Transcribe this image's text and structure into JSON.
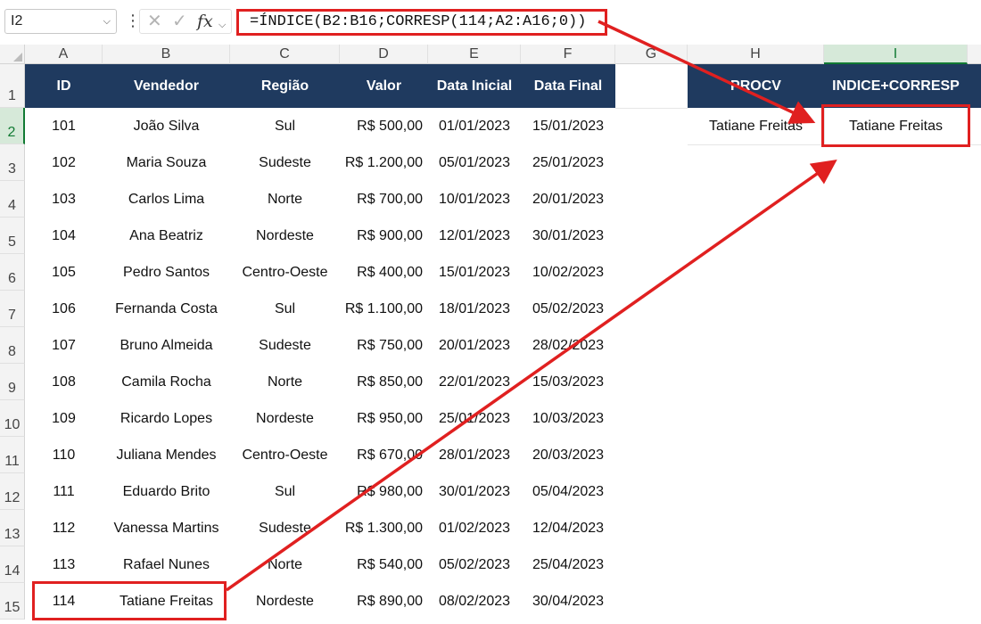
{
  "formula_bar": {
    "name_box": "I2",
    "cancel_glyph": "✕",
    "enter_glyph": "✓",
    "fx_label": "fx",
    "formula": "=ÍNDICE(B2:B16;CORRESP(114;A2:A16;0))"
  },
  "columns": [
    "A",
    "B",
    "C",
    "D",
    "E",
    "F",
    "G",
    "H",
    "I"
  ],
  "rows": [
    "1",
    "2",
    "3",
    "4",
    "5",
    "6",
    "7",
    "8",
    "9",
    "10",
    "11",
    "12",
    "13",
    "14",
    "15"
  ],
  "table": {
    "headers": [
      "ID",
      "Vendedor",
      "Região",
      "Valor",
      "Data Inicial",
      "Data Final"
    ],
    "rows": [
      [
        "101",
        "João Silva",
        "Sul",
        "R$ 500,00",
        "01/01/2023",
        "15/01/2023"
      ],
      [
        "102",
        "Maria Souza",
        "Sudeste",
        "R$ 1.200,00",
        "05/01/2023",
        "25/01/2023"
      ],
      [
        "103",
        "Carlos Lima",
        "Norte",
        "R$ 700,00",
        "10/01/2023",
        "20/01/2023"
      ],
      [
        "104",
        "Ana Beatriz",
        "Nordeste",
        "R$ 900,00",
        "12/01/2023",
        "30/01/2023"
      ],
      [
        "105",
        "Pedro Santos",
        "Centro-Oeste",
        "R$ 400,00",
        "15/01/2023",
        "10/02/2023"
      ],
      [
        "106",
        "Fernanda Costa",
        "Sul",
        "R$ 1.100,00",
        "18/01/2023",
        "05/02/2023"
      ],
      [
        "107",
        "Bruno Almeida",
        "Sudeste",
        "R$ 750,00",
        "20/01/2023",
        "28/02/2023"
      ],
      [
        "108",
        "Camila Rocha",
        "Norte",
        "R$ 850,00",
        "22/01/2023",
        "15/03/2023"
      ],
      [
        "109",
        "Ricardo Lopes",
        "Nordeste",
        "R$ 950,00",
        "25/01/2023",
        "10/03/2023"
      ],
      [
        "110",
        "Juliana Mendes",
        "Centro-Oeste",
        "R$ 670,00",
        "28/01/2023",
        "20/03/2023"
      ],
      [
        "111",
        "Eduardo Brito",
        "Sul",
        "R$ 980,00",
        "30/01/2023",
        "05/04/2023"
      ],
      [
        "112",
        "Vanessa Martins",
        "Sudeste",
        "R$ 1.300,00",
        "01/02/2023",
        "12/04/2023"
      ],
      [
        "113",
        "Rafael Nunes",
        "Norte",
        "R$ 540,00",
        "05/02/2023",
        "25/04/2023"
      ],
      [
        "114",
        "Tatiane Freitas",
        "Nordeste",
        "R$ 890,00",
        "08/02/2023",
        "30/04/2023"
      ]
    ]
  },
  "lookup": {
    "headers": [
      "PROCV",
      "INDICE+CORRESP"
    ],
    "values": [
      "Tatiane Freitas",
      "Tatiane Freitas"
    ]
  },
  "colors": {
    "header_fill": "#1f3a5f",
    "highlight_red": "#e02020",
    "active_green": "#117a33"
  }
}
